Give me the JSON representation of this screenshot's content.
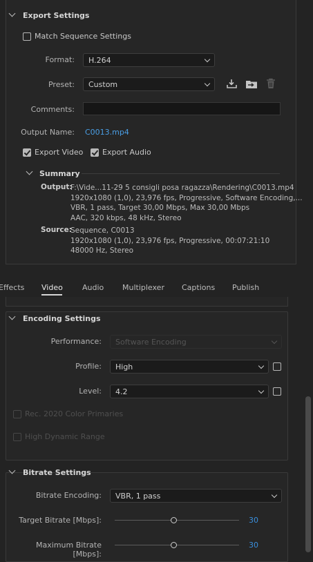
{
  "export_settings": {
    "title": "Export Settings",
    "match_sequence_label": "Match Sequence Settings",
    "format_label": "Format:",
    "format_value": "H.264",
    "preset_label": "Preset:",
    "preset_value": "Custom",
    "comments_label": "Comments:",
    "comments_value": "",
    "output_name_label": "Output Name:",
    "output_name_value": "C0013.mp4",
    "export_video_label": "Export Video",
    "export_video_checked": true,
    "export_audio_label": "Export Audio",
    "export_audio_checked": true,
    "match_sequence_checked": false
  },
  "summary": {
    "title": "Summary",
    "output_label": "Output:",
    "output_lines": [
      "F:\\Vide...11-29 5 consigli posa ragazza\\Rendering\\C0013.mp4",
      "1920x1080 (1,0), 23,976 fps, Progressive, Software Encoding,...",
      "VBR, 1 pass, Target 30,00 Mbps, Max 30,00 Mbps",
      "AAC, 320 kbps, 48 kHz, Stereo"
    ],
    "source_label": "Source:",
    "source_lines": [
      "Sequence, C0013",
      "1920x1080 (1,0), 23,976 fps, Progressive, 00:07:21:10",
      "48000 Hz, Stereo"
    ]
  },
  "tabs": [
    "Effects",
    "Video",
    "Audio",
    "Multiplexer",
    "Captions",
    "Publish"
  ],
  "active_tab": "Video",
  "encoding_settings": {
    "title": "Encoding Settings",
    "performance_label": "Performance:",
    "performance_value": "Software Encoding",
    "profile_label": "Profile:",
    "profile_value": "High",
    "level_label": "Level:",
    "level_value": "4.2",
    "rec2020_label": "Rec. 2020 Color Primaries",
    "hdr_label": "High Dynamic Range"
  },
  "bitrate_settings": {
    "title": "Bitrate Settings",
    "bitrate_encoding_label": "Bitrate Encoding:",
    "bitrate_encoding_value": "VBR, 1 pass",
    "target_label": "Target Bitrate [Mbps]:",
    "target_value": "30",
    "max_label": "Maximum Bitrate [Mbps]:",
    "max_value": "30"
  },
  "icons": [
    "save-preset-icon",
    "import-preset-icon",
    "delete-preset-icon"
  ],
  "colors": {
    "accent": "#4a9fe6",
    "background": "#232323",
    "panel": "#262626"
  }
}
